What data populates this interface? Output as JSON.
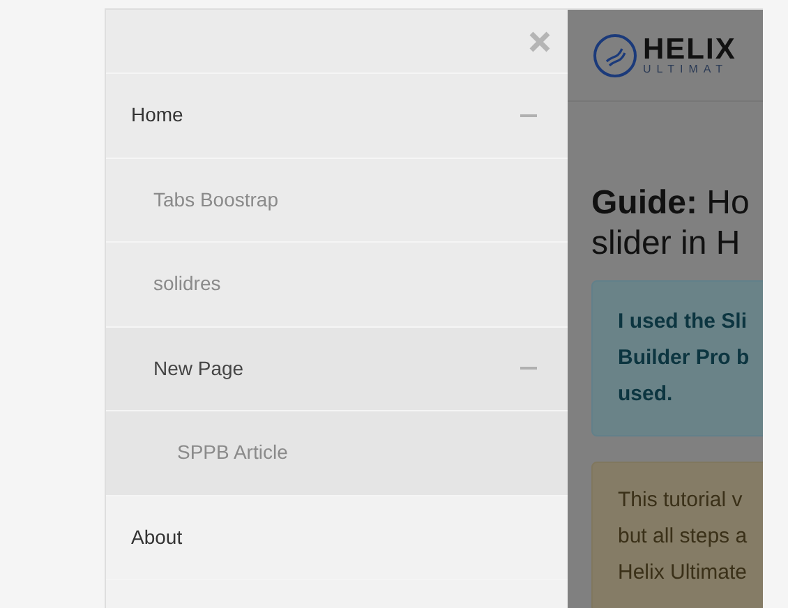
{
  "menu": {
    "items": [
      {
        "label": "Home",
        "expanded": true,
        "children": [
          {
            "label": "Tabs Boostrap"
          },
          {
            "label": "solidres"
          },
          {
            "label": "New Page",
            "expanded": true,
            "children": [
              {
                "label": "SPPB Article"
              }
            ]
          }
        ]
      },
      {
        "label": "About"
      }
    ]
  },
  "page": {
    "logo": {
      "name": "HELIX",
      "tagline": "ULTIMAT"
    },
    "heading_lines": [
      "**Guide:** Ho",
      "slider in H"
    ],
    "info_lines": [
      "I used the Sli",
      "Builder Pro b",
      "used."
    ],
    "warning_lines": [
      "This tutorial v",
      "but all steps a",
      "Helix Ultimate"
    ]
  }
}
